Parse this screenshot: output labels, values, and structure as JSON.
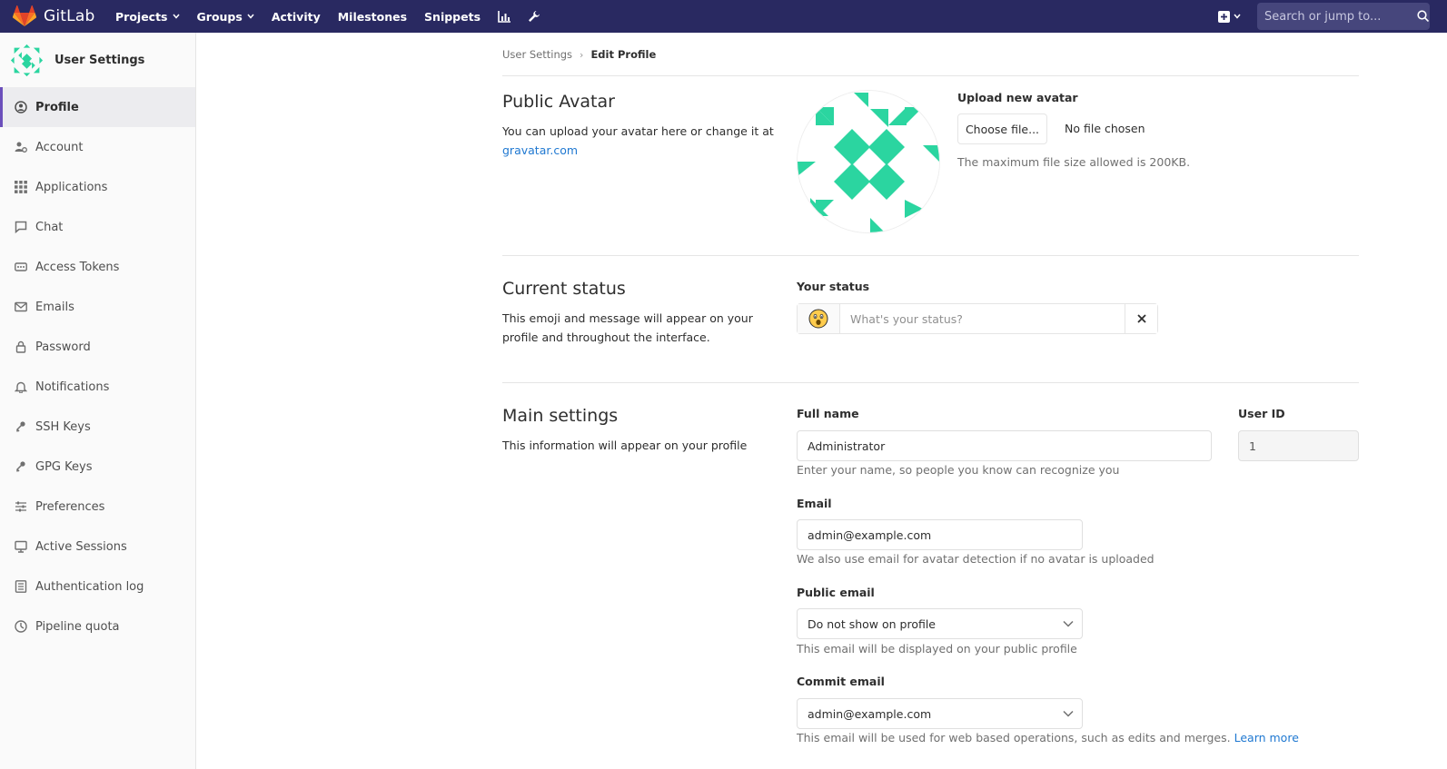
{
  "navbar": {
    "brand": "GitLab",
    "links": [
      {
        "label": "Projects",
        "dropdown": true
      },
      {
        "label": "Groups",
        "dropdown": true
      },
      {
        "label": "Activity",
        "dropdown": false
      },
      {
        "label": "Milestones",
        "dropdown": false
      },
      {
        "label": "Snippets",
        "dropdown": false
      }
    ],
    "icons": [
      "chart-icon",
      "wrench-icon"
    ],
    "search_placeholder": "Search or jump to...",
    "bg_color": "#292961"
  },
  "sidebar": {
    "title": "User Settings",
    "items": [
      {
        "label": "Profile",
        "icon": "profile-icon",
        "active": true
      },
      {
        "label": "Account",
        "icon": "account-icon",
        "active": false
      },
      {
        "label": "Applications",
        "icon": "applications-icon",
        "active": false
      },
      {
        "label": "Chat",
        "icon": "chat-icon",
        "active": false
      },
      {
        "label": "Access Tokens",
        "icon": "token-icon",
        "active": false
      },
      {
        "label": "Emails",
        "icon": "mail-icon",
        "active": false
      },
      {
        "label": "Password",
        "icon": "lock-icon",
        "active": false
      },
      {
        "label": "Notifications",
        "icon": "bell-icon",
        "active": false
      },
      {
        "label": "SSH Keys",
        "icon": "key-icon",
        "active": false
      },
      {
        "label": "GPG Keys",
        "icon": "key-icon",
        "active": false
      },
      {
        "label": "Preferences",
        "icon": "sliders-icon",
        "active": false
      },
      {
        "label": "Active Sessions",
        "icon": "monitor-icon",
        "active": false
      },
      {
        "label": "Authentication log",
        "icon": "log-icon",
        "active": false
      },
      {
        "label": "Pipeline quota",
        "icon": "quota-icon",
        "active": false
      }
    ]
  },
  "breadcrumb": [
    "User Settings",
    "Edit Profile"
  ],
  "avatar_section": {
    "title": "Public Avatar",
    "desc": "You can upload your avatar here or change it at",
    "link": "gravatar.com",
    "upload_label": "Upload new avatar",
    "choose_button": "Choose file...",
    "no_file": "No file chosen",
    "max_size_help": "The maximum file size allowed is 200KB.",
    "avatar_color": "#2bd5a0"
  },
  "status_section": {
    "title": "Current status",
    "desc": "This emoji and message will appear on your profile and throughout the interface.",
    "label": "Your status",
    "placeholder": "What's your status?"
  },
  "main_section": {
    "title": "Main settings",
    "desc": "This information will appear on your profile",
    "full_name_label": "Full name",
    "full_name_value": "Administrator",
    "full_name_help": "Enter your name, so people you know can recognize you",
    "user_id_label": "User ID",
    "user_id_value": "1",
    "email_label": "Email",
    "email_value": "admin@example.com",
    "email_help": "We also use email for avatar detection if no avatar is uploaded",
    "public_email_label": "Public email",
    "public_email_value": "Do not show on profile",
    "public_email_help": "This email will be displayed on your public profile",
    "commit_email_label": "Commit email",
    "commit_email_value": "admin@example.com",
    "commit_email_help": "This email will be used for web based operations, such as edits and merges.",
    "learn_more": "Learn more"
  }
}
